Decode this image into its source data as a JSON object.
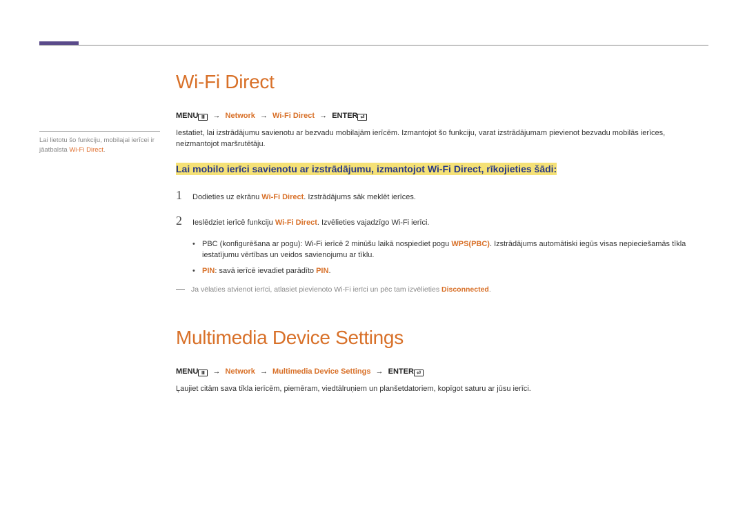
{
  "sidebar": {
    "note_pre": "Lai lietotu šo funkciju, mobilajai ierīcei ir jāatbalsta ",
    "note_accent": "Wi-Fi Direct",
    "note_post": "."
  },
  "section1": {
    "title": "Wi-Fi Direct",
    "menu_label": "MENU",
    "menu_icon": "Ⅲ",
    "arrow": "→",
    "nav_network": "Network",
    "nav_item": "Wi-Fi Direct",
    "enter_label": "ENTER",
    "enter_icon": "⏎",
    "intro": "Iestatiet, lai izstrādājumu savienotu ar bezvadu mobilajām ierīcēm. Izmantojot šo funkciju, varat izstrādājumam pievienot bezvadu mobilās ierīces, neizmantojot maršrutētāju.",
    "highlight": "Lai mobilo ierīci savienotu ar izstrādājumu, izmantojot Wi-Fi Direct, rīkojieties šādi:",
    "step1": {
      "num": "1",
      "pre": "Dodieties uz ekrānu ",
      "accent": "Wi-Fi Direct",
      "post": ". Izstrādājums sāk meklēt ierīces."
    },
    "step2": {
      "num": "2",
      "pre": "Ieslēdziet ierīcē funkciju ",
      "accent": "Wi-Fi Direct",
      "post": ". Izvēlieties vajadzīgo Wi-Fi ierīci."
    },
    "bullet1": {
      "pre": "PBC (konfigurēšana ar pogu): Wi-Fi ierīcē 2 minūšu laikā nospiediet pogu ",
      "accent": "WPS(PBC)",
      "post": ". Izstrādājums automātiski iegūs visas nepieciešamās tīkla iestatījumu vērtības un veidos savienojumu ar tīklu."
    },
    "bullet2": {
      "accent1": "PIN",
      "mid": ": savā ierīcē ievadiet parādīto ",
      "accent2": "PIN",
      "post": "."
    },
    "footnote": {
      "pre": "Ja vēlaties atvienot ierīci, atlasiet pievienoto Wi-Fi ierīci un pēc tam izvēlieties ",
      "accent": "Disconnected",
      "post": "."
    }
  },
  "section2": {
    "title": "Multimedia Device Settings",
    "menu_label": "MENU",
    "menu_icon": "Ⅲ",
    "arrow": "→",
    "nav_network": "Network",
    "nav_item": "Multimedia Device Settings",
    "enter_label": "ENTER",
    "enter_icon": "⏎",
    "body": "Ļaujiet citām sava tīkla ierīcēm, piemēram, viedtālruņiem un planšetdatoriem, kopīgot saturu ar jūsu ierīci."
  }
}
